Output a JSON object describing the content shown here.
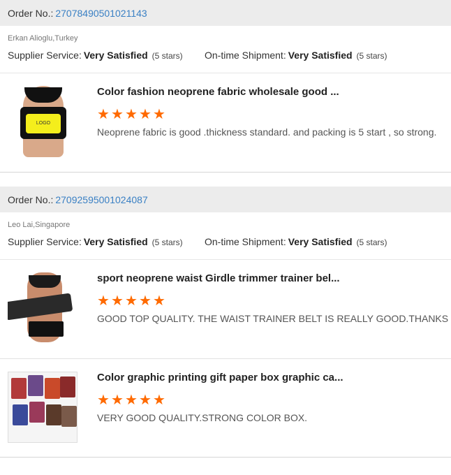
{
  "labels": {
    "order_no": "Order No.:",
    "supplier_service": "Supplier Service:",
    "ontime_shipment": "On-time Shipment:"
  },
  "orders": [
    {
      "number": "27078490501021143",
      "buyer": "Erkan Alioglu,Turkey",
      "supplier_rating": "Very Satisfied",
      "supplier_stars": "(5 stars)",
      "shipment_rating": "Very Satisfied",
      "shipment_stars": "(5 stars)",
      "items": [
        {
          "title": "Color fashion neoprene fabric wholesale good ...",
          "stars": 5,
          "comment": "Neoprene fabric is good .thickness standard. and packing is 5 start , so strong.",
          "thumb_logo": "LOGO"
        }
      ]
    },
    {
      "number": "27092595001024087",
      "buyer": "Leo Lai,Singapore",
      "supplier_rating": "Very Satisfied",
      "supplier_stars": "(5 stars)",
      "shipment_rating": "Very Satisfied",
      "shipment_stars": "(5 stars)",
      "items": [
        {
          "title": "sport neoprene waist Girdle trimmer trainer bel...",
          "stars": 5,
          "comment": "GOOD TOP QUALITY. THE WAIST TRAINER BELT IS REALLY GOOD.THANKS ."
        },
        {
          "title": "Color graphic printing gift paper box graphic ca...",
          "stars": 5,
          "comment": "VERY GOOD QUALITY.STRONG COLOR BOX."
        }
      ]
    }
  ],
  "colors": {
    "star": "#ff6a00",
    "order_number_link": "#3a80c4",
    "header_bg": "#ececec"
  },
  "icons": {
    "star": "star-icon"
  }
}
